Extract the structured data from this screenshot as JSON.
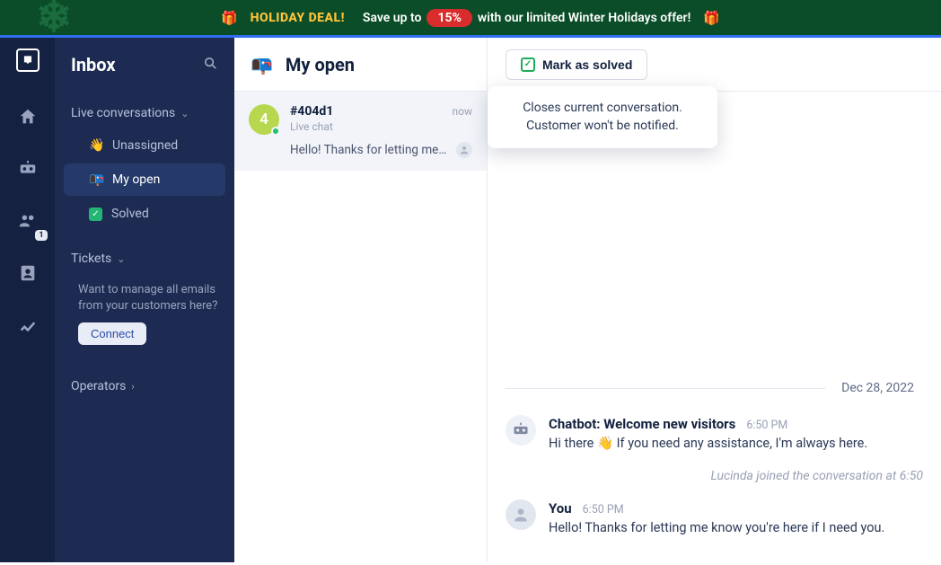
{
  "banner": {
    "deal": "HOLIDAY DEAL!",
    "save": "Save up to",
    "pct": "15%",
    "rest": "with our limited Winter Holidays offer!"
  },
  "sidebar": {
    "title": "Inbox",
    "group_live": "Live conversations",
    "items": {
      "unassigned": "Unassigned",
      "my_open": "My open",
      "solved": "Solved"
    },
    "tickets_label": "Tickets",
    "tickets_desc": "Want to manage all emails from your customers here?",
    "connect": "Connect",
    "operators": "Operators"
  },
  "rail": {
    "group_badge": "1"
  },
  "list": {
    "title": "My open",
    "card": {
      "avatar": "4",
      "id": "#404d1",
      "time": "now",
      "type": "Live chat",
      "preview": "Hello! Thanks for letting me kno..."
    }
  },
  "chat": {
    "mark_solved": "Mark as solved",
    "tooltip_l1": "Closes current conversation.",
    "tooltip_l2": "Customer won't be notified.",
    "date": "Dec 28, 2022",
    "bot_name": "Chatbot: Welcome new visitors",
    "bot_time": "6:50 PM",
    "bot_msg_pre": "Hi there ",
    "bot_msg_post": " If you need any assistance, I'm always here.",
    "system": "Lucinda joined the conversation at 6:50 ",
    "you_name": "You",
    "you_time": "6:50 PM",
    "you_msg": "Hello! Thanks for letting me know you're here if I need you."
  }
}
